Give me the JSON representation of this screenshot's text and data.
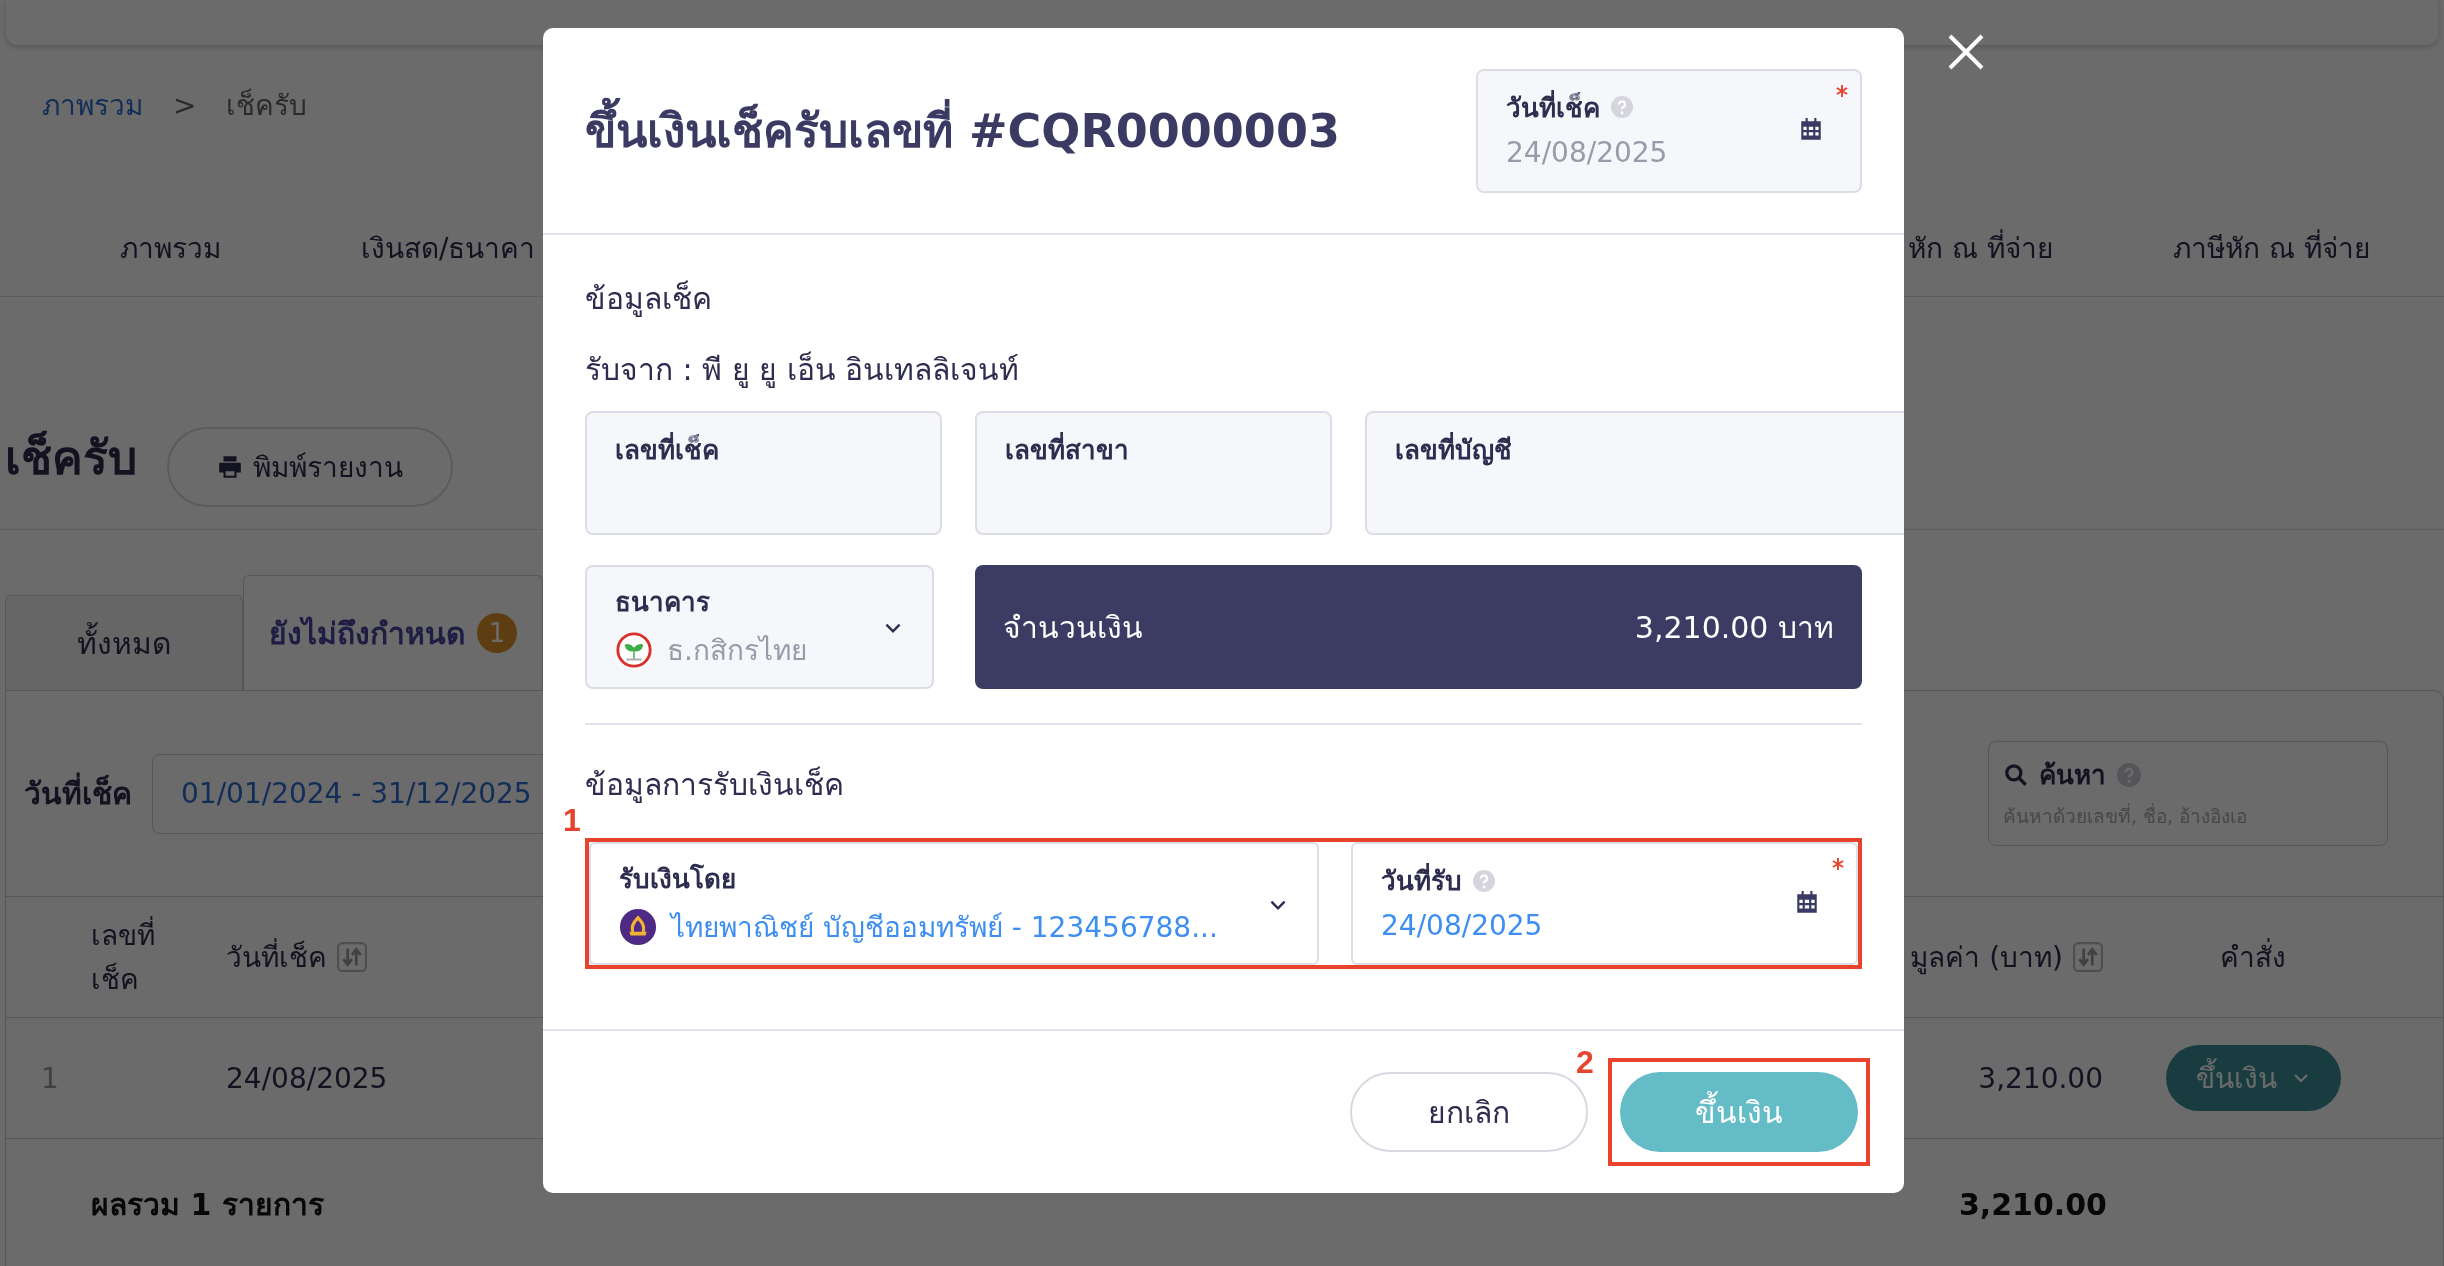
{
  "breadcrumb": {
    "items": [
      {
        "label": "ภาพรวม",
        "kind": "link"
      },
      {
        "label": "เช็ครับ",
        "kind": "current"
      }
    ],
    "separator": ">"
  },
  "nav_tabs": {
    "left": [
      "ภาพรวม",
      "เงินสด/ธนาคา"
    ],
    "right": [
      "หัก ณ ที่จ่าย",
      "ภาษีหัก ณ ที่จ่าย"
    ]
  },
  "page_title": "เช็ครับ",
  "print_button": "พิมพ์รายงาน",
  "status_tabs": [
    {
      "label": "ทั้งหมด",
      "selected": false
    },
    {
      "label": "ยังไม่ถึงกำหนด",
      "selected": true,
      "count": "1"
    }
  ],
  "filter": {
    "label": "วันที่เช็ค",
    "value": "01/01/2024 - 31/12/2025"
  },
  "search": {
    "label": "ค้นหา",
    "placeholder": "ค้นหาด้วยเลขที่, ชื่อ, อ้างอิงเอ"
  },
  "table": {
    "columns_left": [
      {
        "label": "เลขที่เช็ค",
        "sortable": false
      },
      {
        "label": "วันที่เช็ค",
        "sortable": true
      }
    ],
    "columns_right": [
      {
        "label": "มูลค่า (บาท)",
        "sortable": true
      },
      {
        "label": "คำสั่ง",
        "sortable": false
      }
    ],
    "rows": [
      {
        "index": "1",
        "date": "24/08/2025",
        "amount": "3,210.00",
        "action": "ขึ้นเงิน"
      }
    ],
    "total": {
      "label": "ผลรวม 1 รายการ",
      "amount": "3,210.00"
    }
  },
  "modal": {
    "title": "ขึ้นเงินเช็ครับเลขที่ #CQR0000003",
    "check_date": {
      "label": "วันที่เช็ค",
      "value": "24/08/2025",
      "required": true,
      "readonly": true
    },
    "section_check": "ข้อมูลเช็ค",
    "received_from": "รับจาก : พี ยู ยู เอ็น อินเทลลิเจนท์",
    "check_fields": [
      "เลขที่เช็ค",
      "เลขที่สาขา",
      "เลขที่บัญชี"
    ],
    "bank": {
      "label": "ธนาคาร",
      "value": "ธ.กสิกรไทย"
    },
    "amount": {
      "label": "จำนวนเงิน",
      "value": "3,210.00 บาท"
    },
    "section_receipt": "ข้อมูลการรับเงินเช็ค",
    "received_by": {
      "label": "รับเงินโดย",
      "value": "ไทยพาณิชย์ บัญชีออมทรัพย์ - 123456788..."
    },
    "received_date": {
      "label": "วันที่รับ",
      "value": "24/08/2025",
      "required": true,
      "readonly": false
    },
    "buttons": [
      {
        "label": "ยกเลิก",
        "kind": "secondary"
      },
      {
        "label": "ขึ้นเงิน",
        "kind": "primary"
      }
    ]
  },
  "annotations": [
    {
      "label": "1"
    },
    {
      "label": "2"
    }
  ]
}
